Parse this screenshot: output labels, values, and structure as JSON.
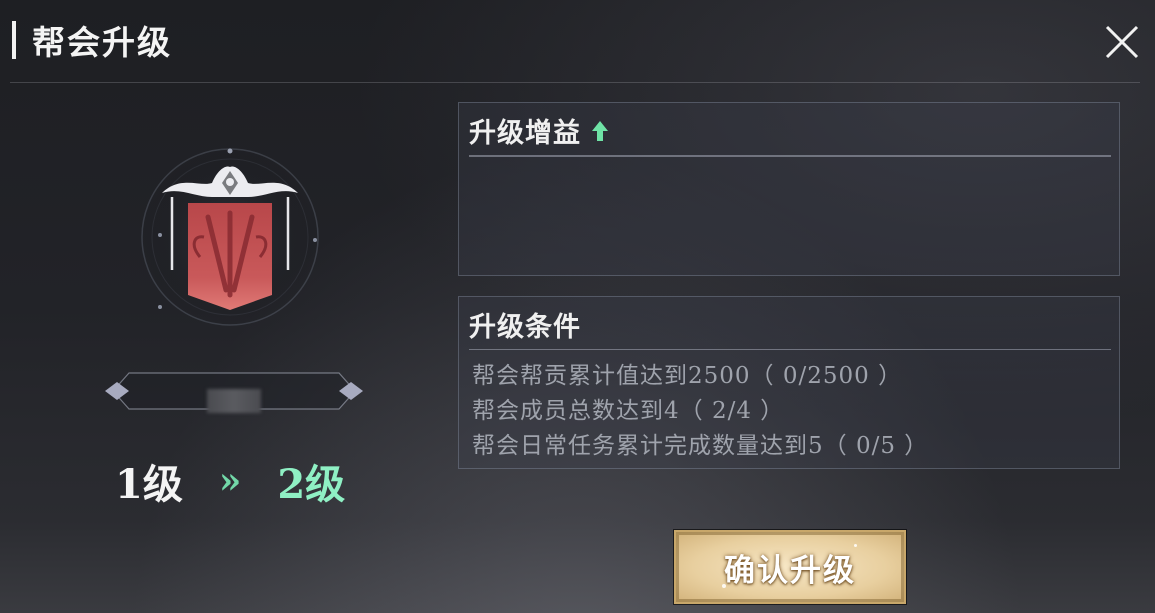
{
  "header": {
    "title": "帮会升级",
    "close_icon": "close-icon"
  },
  "guild": {
    "emblem_icon": "guild-banner-emblem-icon",
    "level_current": "1级",
    "level_arrow": "»",
    "level_next": "2级"
  },
  "benefits": {
    "heading": "升级增益",
    "heading_icon": "up-arrow-icon",
    "items": []
  },
  "conditions": {
    "heading": "升级条件",
    "items": [
      "帮会帮贡累计值达到2500（ 0/2500 ）",
      "帮会成员总数达到4（ 2/4 ）",
      "帮会日常任务累计完成数量达到5（ 0/5 ）"
    ]
  },
  "actions": {
    "confirm_label": "确认升级"
  },
  "colors": {
    "accent_green": "#8ff0c4",
    "condition_text": "#9fa3ac",
    "button_gold": "#e8cf9f"
  }
}
